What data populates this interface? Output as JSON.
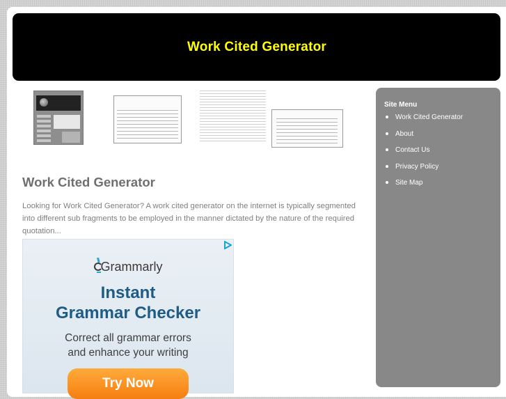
{
  "header": {
    "title": "Work Cited Generator",
    "title_color": "#ffff00",
    "background": "#000000"
  },
  "thumbnails": [
    {
      "name": "citation-software-screenshot"
    },
    {
      "name": "works-cited-document-1"
    },
    {
      "name": "essay-text-page"
    },
    {
      "name": "works-cited-document-2"
    }
  ],
  "content": {
    "title": "Work Cited Generator",
    "summary": "Looking for Work Cited Generator? A work cited generator on the internet is typically segmented into different sub fragments to be employed in the manner dictated by the nature of the required quotation..."
  },
  "ad": {
    "brand": "Grammarly",
    "headline_line1": "Instant",
    "headline_line2": "Grammar Checker",
    "sub_line1": "Correct all grammar errors",
    "sub_line2": "and enhance your writing",
    "cta": "Try Now",
    "headline_color": "#1e5c86",
    "cta_color": "#f58a1f",
    "adchoices_icon": "adchoices-icon"
  },
  "sidebar": {
    "title": "Site Menu",
    "background": "#888888",
    "items": [
      {
        "label": "Work Cited Generator"
      },
      {
        "label": "About"
      },
      {
        "label": "Contact Us"
      },
      {
        "label": "Privacy Policy"
      },
      {
        "label": "Site Map"
      }
    ]
  }
}
